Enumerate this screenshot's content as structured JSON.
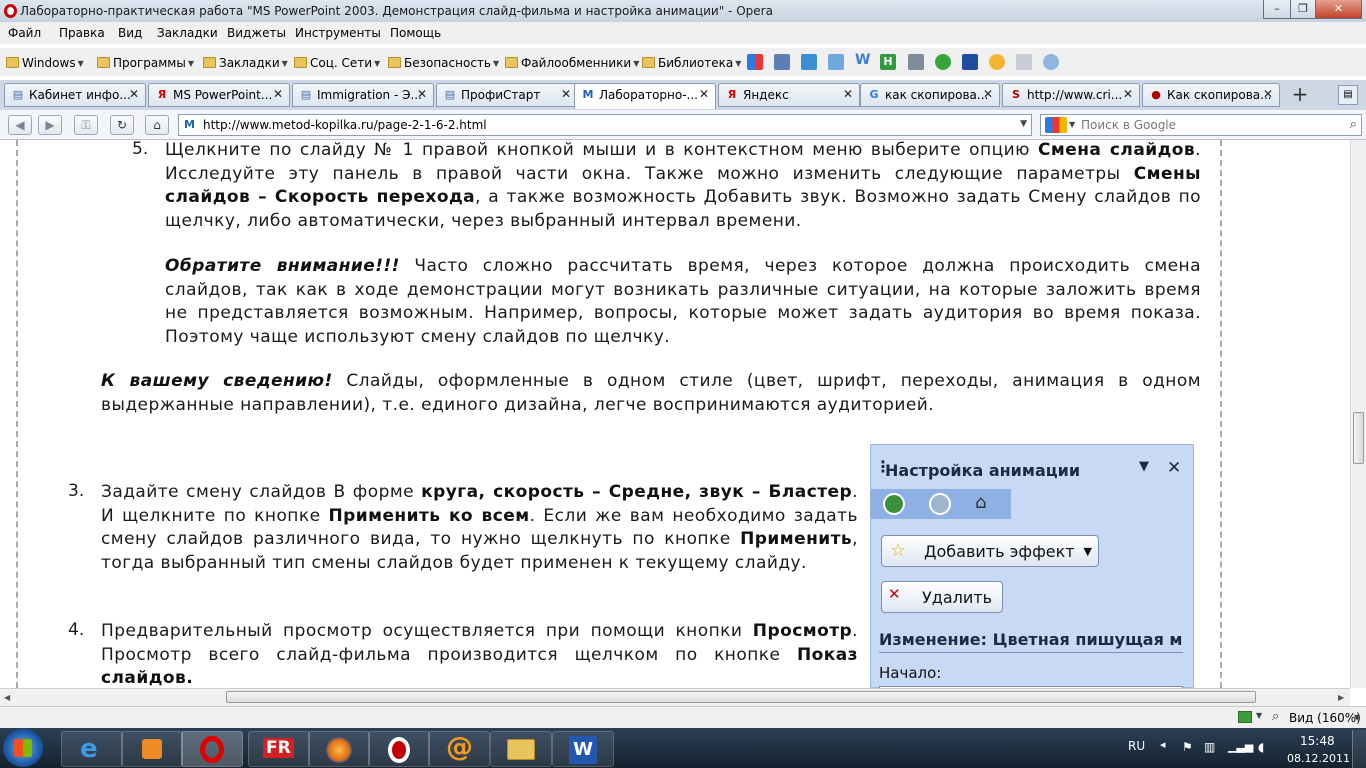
{
  "window": {
    "title": "Лабораторно-практическая работа \"MS PowerPoint 2003. Демонстрация слайд-фильма и настройка анимации\" - Opera",
    "controls": {
      "minimize": "–",
      "restore": "❐",
      "close": "✕"
    }
  },
  "menu": {
    "items": [
      "Файл",
      "Правка",
      "Вид",
      "Закладки",
      "Виджеты",
      "Инструменты",
      "Помощь"
    ]
  },
  "bookmarks": {
    "folders": [
      "Windows",
      "Программы",
      "Закладки",
      "Соц. Сети",
      "Безопасность",
      "Файлообменники",
      "Библиотека"
    ],
    "icons": [
      "google-icon",
      "mail-icon",
      "translate-icon",
      "bird-icon",
      "w-icon",
      "h-icon",
      "play-icon",
      "arrow-icon",
      "face-icon",
      "key-icon",
      "sun-icon"
    ]
  },
  "tabs": [
    {
      "label": "Кабинет инфо...",
      "favicon": "page-icon",
      "fav_char": "▤",
      "color": "#4a6fa5"
    },
    {
      "label": "MS PowerPoint...",
      "favicon": "yandex-icon",
      "fav_char": "Я",
      "color": "#e00000"
    },
    {
      "label": "Immigration - Э...",
      "favicon": "page-icon",
      "fav_char": "▤",
      "color": "#4a6fa5"
    },
    {
      "label": "ПрофиСтарт",
      "favicon": "page-icon",
      "fav_char": "▤",
      "color": "#4a6fa5"
    },
    {
      "label": "Лабораторно-...",
      "favicon": "m-icon",
      "fav_char": "M",
      "color": "#1f5fbf",
      "active": true
    },
    {
      "label": "Яндекс",
      "favicon": "yandex-icon",
      "fav_char": "Я",
      "color": "#e00000"
    },
    {
      "label": "как скопирова...",
      "favicon": "google-icon",
      "fav_char": "G",
      "color": "#2a7ae2"
    },
    {
      "label": "http://www.cri...",
      "favicon": "s-icon",
      "fav_char": "S",
      "color": "#c00000"
    },
    {
      "label": "Как скопирова...",
      "favicon": "red-icon",
      "fav_char": "●",
      "color": "#b00000"
    }
  ],
  "address": {
    "url": "http://www.metod-kopilka.ru/page-2-1-6-2.html",
    "search_placeholder": "Поиск в Google"
  },
  "content": {
    "item5_number": "5.",
    "item5": [
      {
        "t": "Щелкните по слайду № 1 правой кнопкой мыши и в контекстном меню выберите опцию "
      },
      {
        "t": "Смена слайдов",
        "b": true
      },
      {
        "t": ". Исследуйте эту панель в правой части окна. Также можно изменить следующие параметры "
      },
      {
        "t": "Смены слайдов – Скорость перехода",
        "b": true
      },
      {
        "t": ", а также возможность Добавить звук. Возможно задать Смену слайдов по щелчку, либо автоматически, через выбранный интервал времени."
      }
    ],
    "note": [
      {
        "t": "Обратите внимание!!!",
        "b": true,
        "i": true
      },
      {
        "t": " Часто сложно рассчитать время, через которое должна происходить смена слайдов, так как в ходе демонстрации могут возникать различные ситуации, на которые заложить время не представляется возможным. Например, вопросы, которые может задать аудитория во время показа. Поэтому чаще используют смену слайдов по щелчку."
      }
    ],
    "info": [
      {
        "t": "К вашему сведению!",
        "b": true,
        "i": true
      },
      {
        "t": " Слайды, оформленные в одном стиле (цвет, шрифт, переходы, анимация в одном выдержанные направлении), т.е. единого дизайна, легче воспринимаются аудиторией."
      }
    ],
    "item3_number": "3.",
    "item3": [
      {
        "t": "Задайте смену слайдов В форме "
      },
      {
        "t": "круга, скорость – Средне, звук – Бластер",
        "b": true
      },
      {
        "t": ". И щелкните по кнопке "
      },
      {
        "t": "Применить ко всем",
        "b": true
      },
      {
        "t": ". Если же вам необходимо задать смену слайдов различного вида, то нужно щелкнуть по кнопке "
      },
      {
        "t": "Применить",
        "b": true
      },
      {
        "t": ", тогда выбранный тип смены слайдов будет применен к текущему слайду."
      }
    ],
    "item4_number": "4.",
    "item4": [
      {
        "t": "Предварительный просмотр осуществляется при помощи кнопки "
      },
      {
        "t": "Просмотр",
        "b": true
      },
      {
        "t": ". Просмотр всего слайд-фильма производится щелчком по кнопке "
      },
      {
        "t": "Показ слайдов.",
        "b": true
      }
    ]
  },
  "panel": {
    "title": "Настройка анимации",
    "add_effect": "Добавить эффект",
    "delete": "Удалить",
    "change": "Изменение: Цветная пишущая м",
    "start_label": "Начало:"
  },
  "status": {
    "zoom": "Вид (160%)",
    "left_texts": [
      "",
      "",
      ""
    ]
  },
  "taskbar": {
    "lang": "RU",
    "time": "15:48",
    "date": "08.12.2011"
  }
}
